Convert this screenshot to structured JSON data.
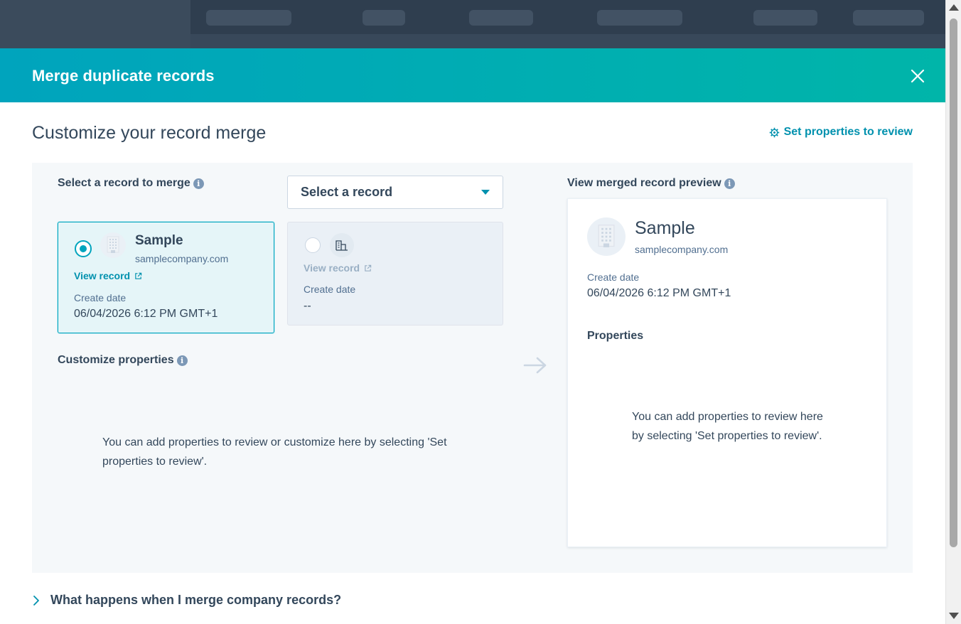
{
  "modal": {
    "title": "Merge duplicate records",
    "close_icon": "close-icon"
  },
  "page": {
    "title": "Customize your record merge",
    "set_properties_link": "Set properties to review",
    "set_properties_icon": "gear-icon"
  },
  "select_section": {
    "label": "Select a record to merge",
    "dropdown_value": "Select a record"
  },
  "primary_record": {
    "name": "Sample",
    "domain": "samplecompany.com",
    "view_record": "View record",
    "create_date_label": "Create date",
    "create_date": "06/04/2026 6:12 PM GMT+1",
    "selected": true
  },
  "secondary_record": {
    "view_record": "View record",
    "create_date_label": "Create date",
    "create_date": "--",
    "selected": false
  },
  "customize": {
    "label": "Customize properties",
    "empty_text": "You can add properties to review or customize here by selecting 'Set properties to review'."
  },
  "preview": {
    "label": "View merged record preview",
    "name": "Sample",
    "domain": "samplecompany.com",
    "create_date_label": "Create date",
    "create_date": "06/04/2026 6:12 PM GMT+1",
    "properties_heading": "Properties",
    "empty_text": "You can add properties to review here by selecting 'Set properties to review'."
  },
  "faq": {
    "question": "What happens when I merge company records?"
  },
  "colors": {
    "accent": "#00a4bd",
    "link": "#0091ae",
    "text": "#33475b",
    "header_gradient_start": "#00a4bd",
    "header_gradient_end": "#00b5a9"
  }
}
